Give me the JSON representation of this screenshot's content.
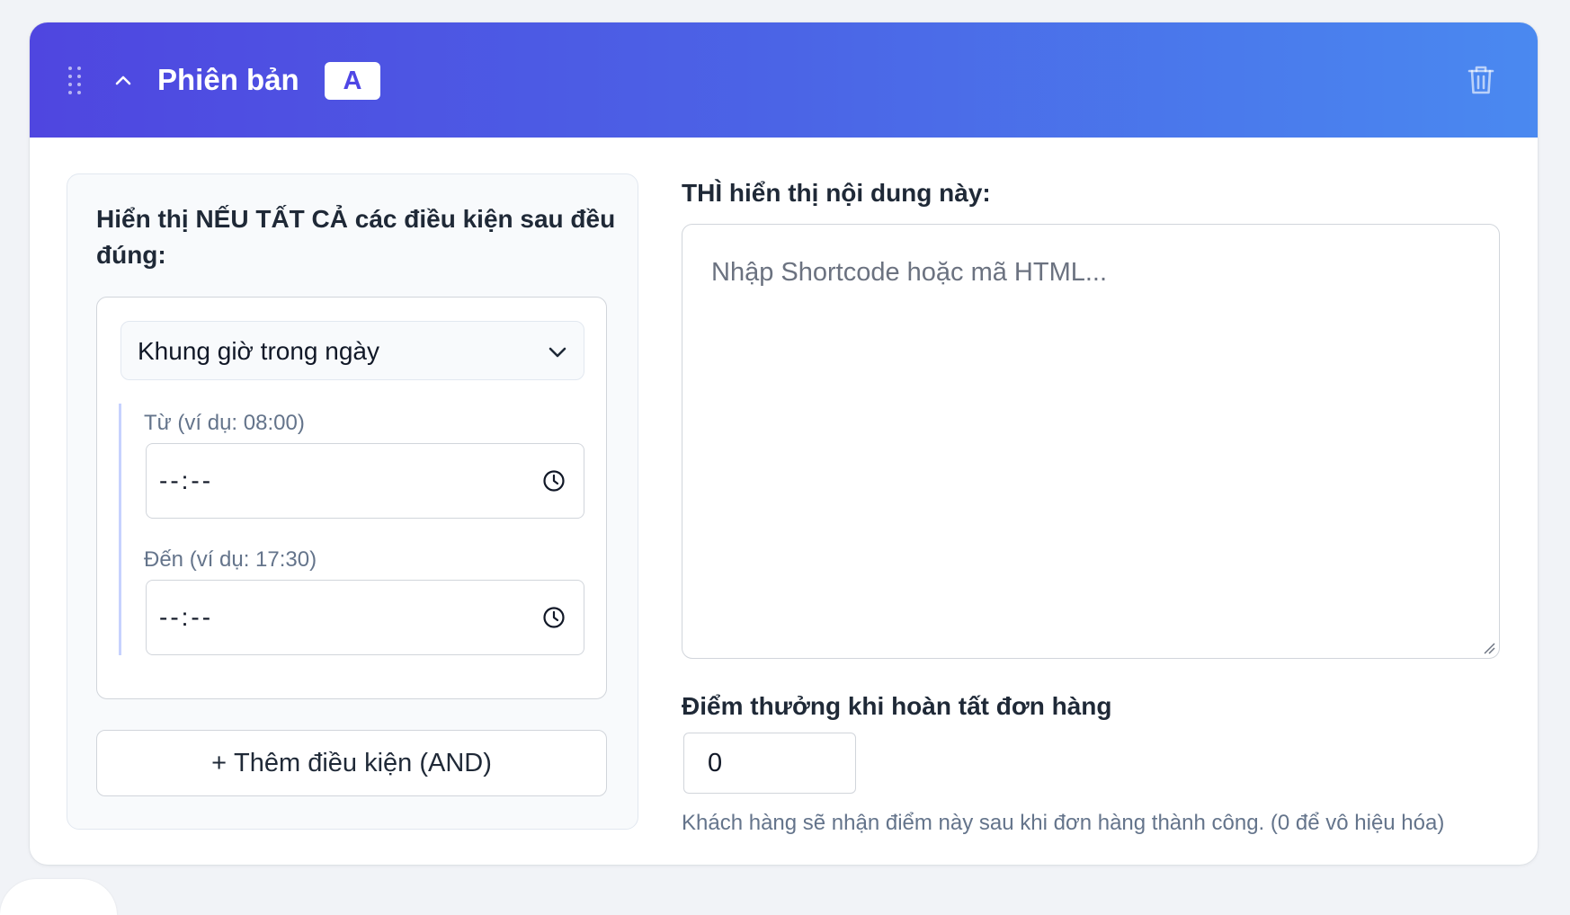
{
  "header": {
    "title": "Phiên bản",
    "badge": "A"
  },
  "conditions": {
    "title": "Hiển thị NẾU TẤT CẢ các điều kiện sau đều đúng:",
    "type_select": {
      "value": "Khung giờ trong ngày"
    },
    "from": {
      "label": "Từ (ví dụ: 08:00)",
      "value": "--:--"
    },
    "to": {
      "label": "Đến (ví dụ: 17:30)",
      "value": "--:--"
    },
    "add_button": {
      "icon": "+",
      "label": "Thêm điều kiện (AND)"
    }
  },
  "content": {
    "title": "THÌ hiển thị nội dung này:",
    "placeholder": "Nhập Shortcode hoặc mã HTML..."
  },
  "points": {
    "label": "Điểm thưởng khi hoàn tất đơn hàng",
    "value": "0",
    "help": "Khách hàng sẽ nhận điểm này sau khi đơn hàng thành công. (0 để vô hiệu hóa)"
  },
  "colors": {
    "header_gradient_start": "#4f46e0",
    "header_gradient_end": "#4a89f0",
    "badge_text": "#4f46e5",
    "condition_rule": "#c7d2fe"
  },
  "icons": {
    "drag": "drag-handle-icon",
    "collapse": "chevron-up-icon",
    "delete": "trash-icon",
    "dropdown": "chevron-down-icon",
    "time": "clock-icon"
  }
}
